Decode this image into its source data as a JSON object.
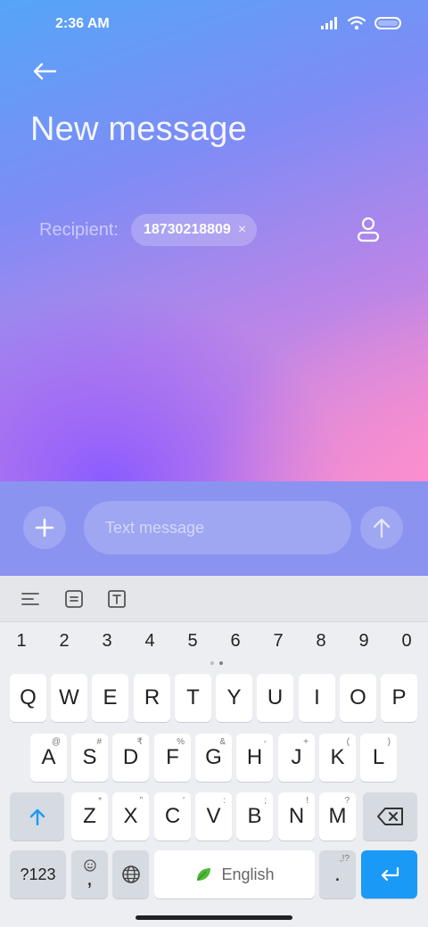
{
  "status": {
    "time": "2:36 AM"
  },
  "header": {
    "title": "New message"
  },
  "recipient": {
    "label": "Recipient:",
    "chip": "18730218809",
    "chip_close": "×"
  },
  "compose": {
    "placeholder": "Text message"
  },
  "keyboard": {
    "numbers": [
      "1",
      "2",
      "3",
      "4",
      "5",
      "6",
      "7",
      "8",
      "9",
      "0"
    ],
    "row1": [
      "Q",
      "W",
      "E",
      "R",
      "T",
      "Y",
      "U",
      "I",
      "O",
      "P"
    ],
    "row2": [
      {
        "k": "A",
        "h": "@"
      },
      {
        "k": "S",
        "h": "#"
      },
      {
        "k": "D",
        "h": "₹"
      },
      {
        "k": "F",
        "h": "%"
      },
      {
        "k": "G",
        "h": "&"
      },
      {
        "k": "H",
        "h": "-"
      },
      {
        "k": "J",
        "h": "+"
      },
      {
        "k": "K",
        "h": "("
      },
      {
        "k": "L",
        "h": ")"
      }
    ],
    "row3": [
      {
        "k": "Z",
        "h": "*"
      },
      {
        "k": "X",
        "h": "\""
      },
      {
        "k": "C",
        "h": "'"
      },
      {
        "k": "V",
        "h": ":"
      },
      {
        "k": "B",
        "h": ";"
      },
      {
        "k": "N",
        "h": "!"
      },
      {
        "k": "M",
        "h": "?"
      }
    ],
    "symbols_label": "?123",
    "comma": ",",
    "space_label": "English",
    "period": ".",
    "period_hint": ",!?"
  },
  "colors": {
    "accent": "#1a9af6",
    "compose_bg": "#8a93f0"
  }
}
